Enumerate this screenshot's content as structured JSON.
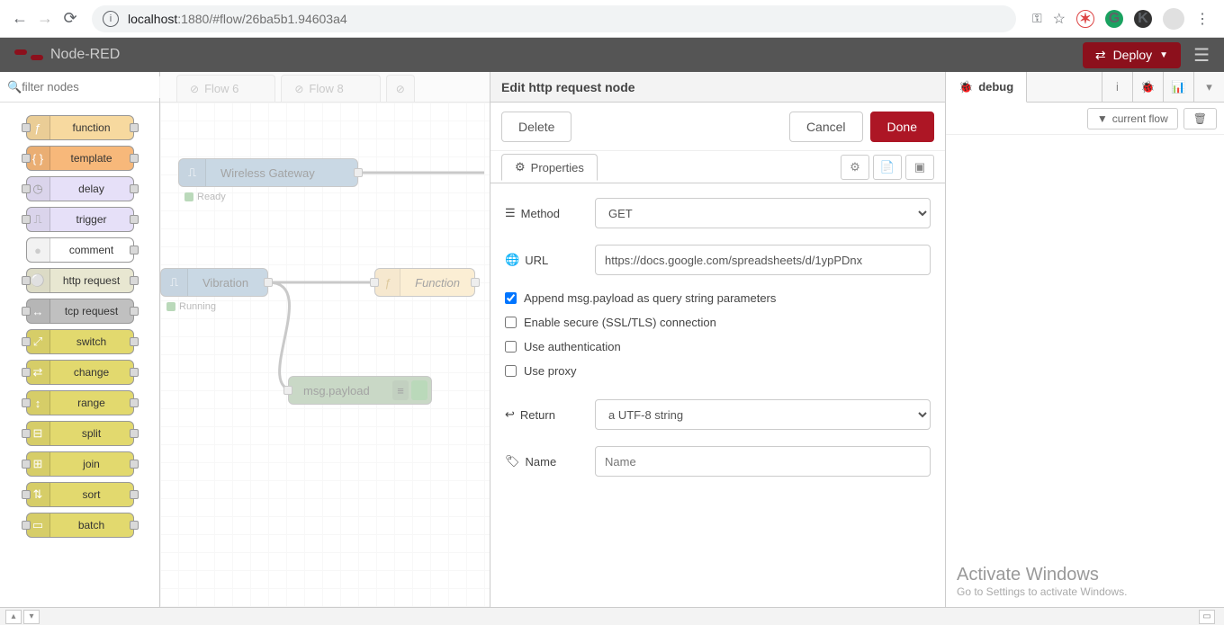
{
  "browser": {
    "url_domain": "localhost",
    "url_port": ":1880",
    "url_path": "/#flow/26ba5b1.94603a4"
  },
  "header": {
    "app_name": "Node-RED",
    "deploy": "Deploy"
  },
  "palette": {
    "filter_placeholder": "filter nodes",
    "nodes": [
      "function",
      "template",
      "delay",
      "trigger",
      "comment",
      "http request",
      "tcp request",
      "switch",
      "change",
      "range",
      "split",
      "join",
      "sort",
      "batch"
    ]
  },
  "tabs": [
    "Flow 6",
    "Flow 8"
  ],
  "flow_nodes": {
    "gateway": {
      "label": "Wireless Gateway",
      "status": "Ready"
    },
    "vibration": {
      "label": "Vibration",
      "status": "Running"
    },
    "function": {
      "label": "Function"
    },
    "debug": {
      "label": "msg.payload"
    }
  },
  "edit": {
    "title": "Edit http request node",
    "delete": "Delete",
    "cancel": "Cancel",
    "done": "Done",
    "properties": "Properties",
    "labels": {
      "method": "Method",
      "url": "URL",
      "return": "Return",
      "name": "Name"
    },
    "method_value": "GET",
    "url_value": "https://docs.google.com/spreadsheets/d/1ypPDnx",
    "check_append": "Append msg.payload as query string parameters",
    "check_ssl": "Enable secure (SSL/TLS) connection",
    "check_auth": "Use authentication",
    "check_proxy": "Use proxy",
    "return_value": "a UTF-8 string",
    "name_placeholder": "Name"
  },
  "sidebar": {
    "tab": "debug",
    "current_flow": "current flow"
  },
  "watermark": {
    "title": "Activate Windows",
    "sub": "Go to Settings to activate Windows."
  }
}
